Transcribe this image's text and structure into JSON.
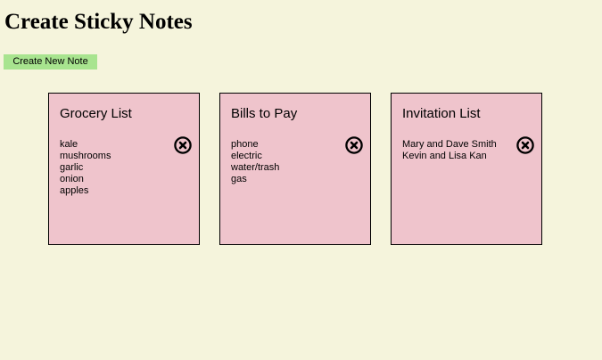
{
  "header": {
    "title": "Create Sticky Notes",
    "create_button_label": "Create New Note"
  },
  "colors": {
    "background": "#f5f4dc",
    "note": "#efc4cc",
    "button": "#a8e48f"
  },
  "notes": [
    {
      "title": "Grocery List",
      "items": [
        "kale",
        "mushrooms",
        "garlic",
        "onion",
        "apples"
      ],
      "delete_icon": "close-circle-icon"
    },
    {
      "title": "Bills to Pay",
      "items": [
        "phone",
        "electric",
        "water/trash",
        "gas"
      ],
      "delete_icon": "close-circle-icon"
    },
    {
      "title": "Invitation List",
      "items": [
        "Mary and Dave Smith",
        "Kevin and Lisa Kan"
      ],
      "delete_icon": "close-circle-icon"
    }
  ]
}
